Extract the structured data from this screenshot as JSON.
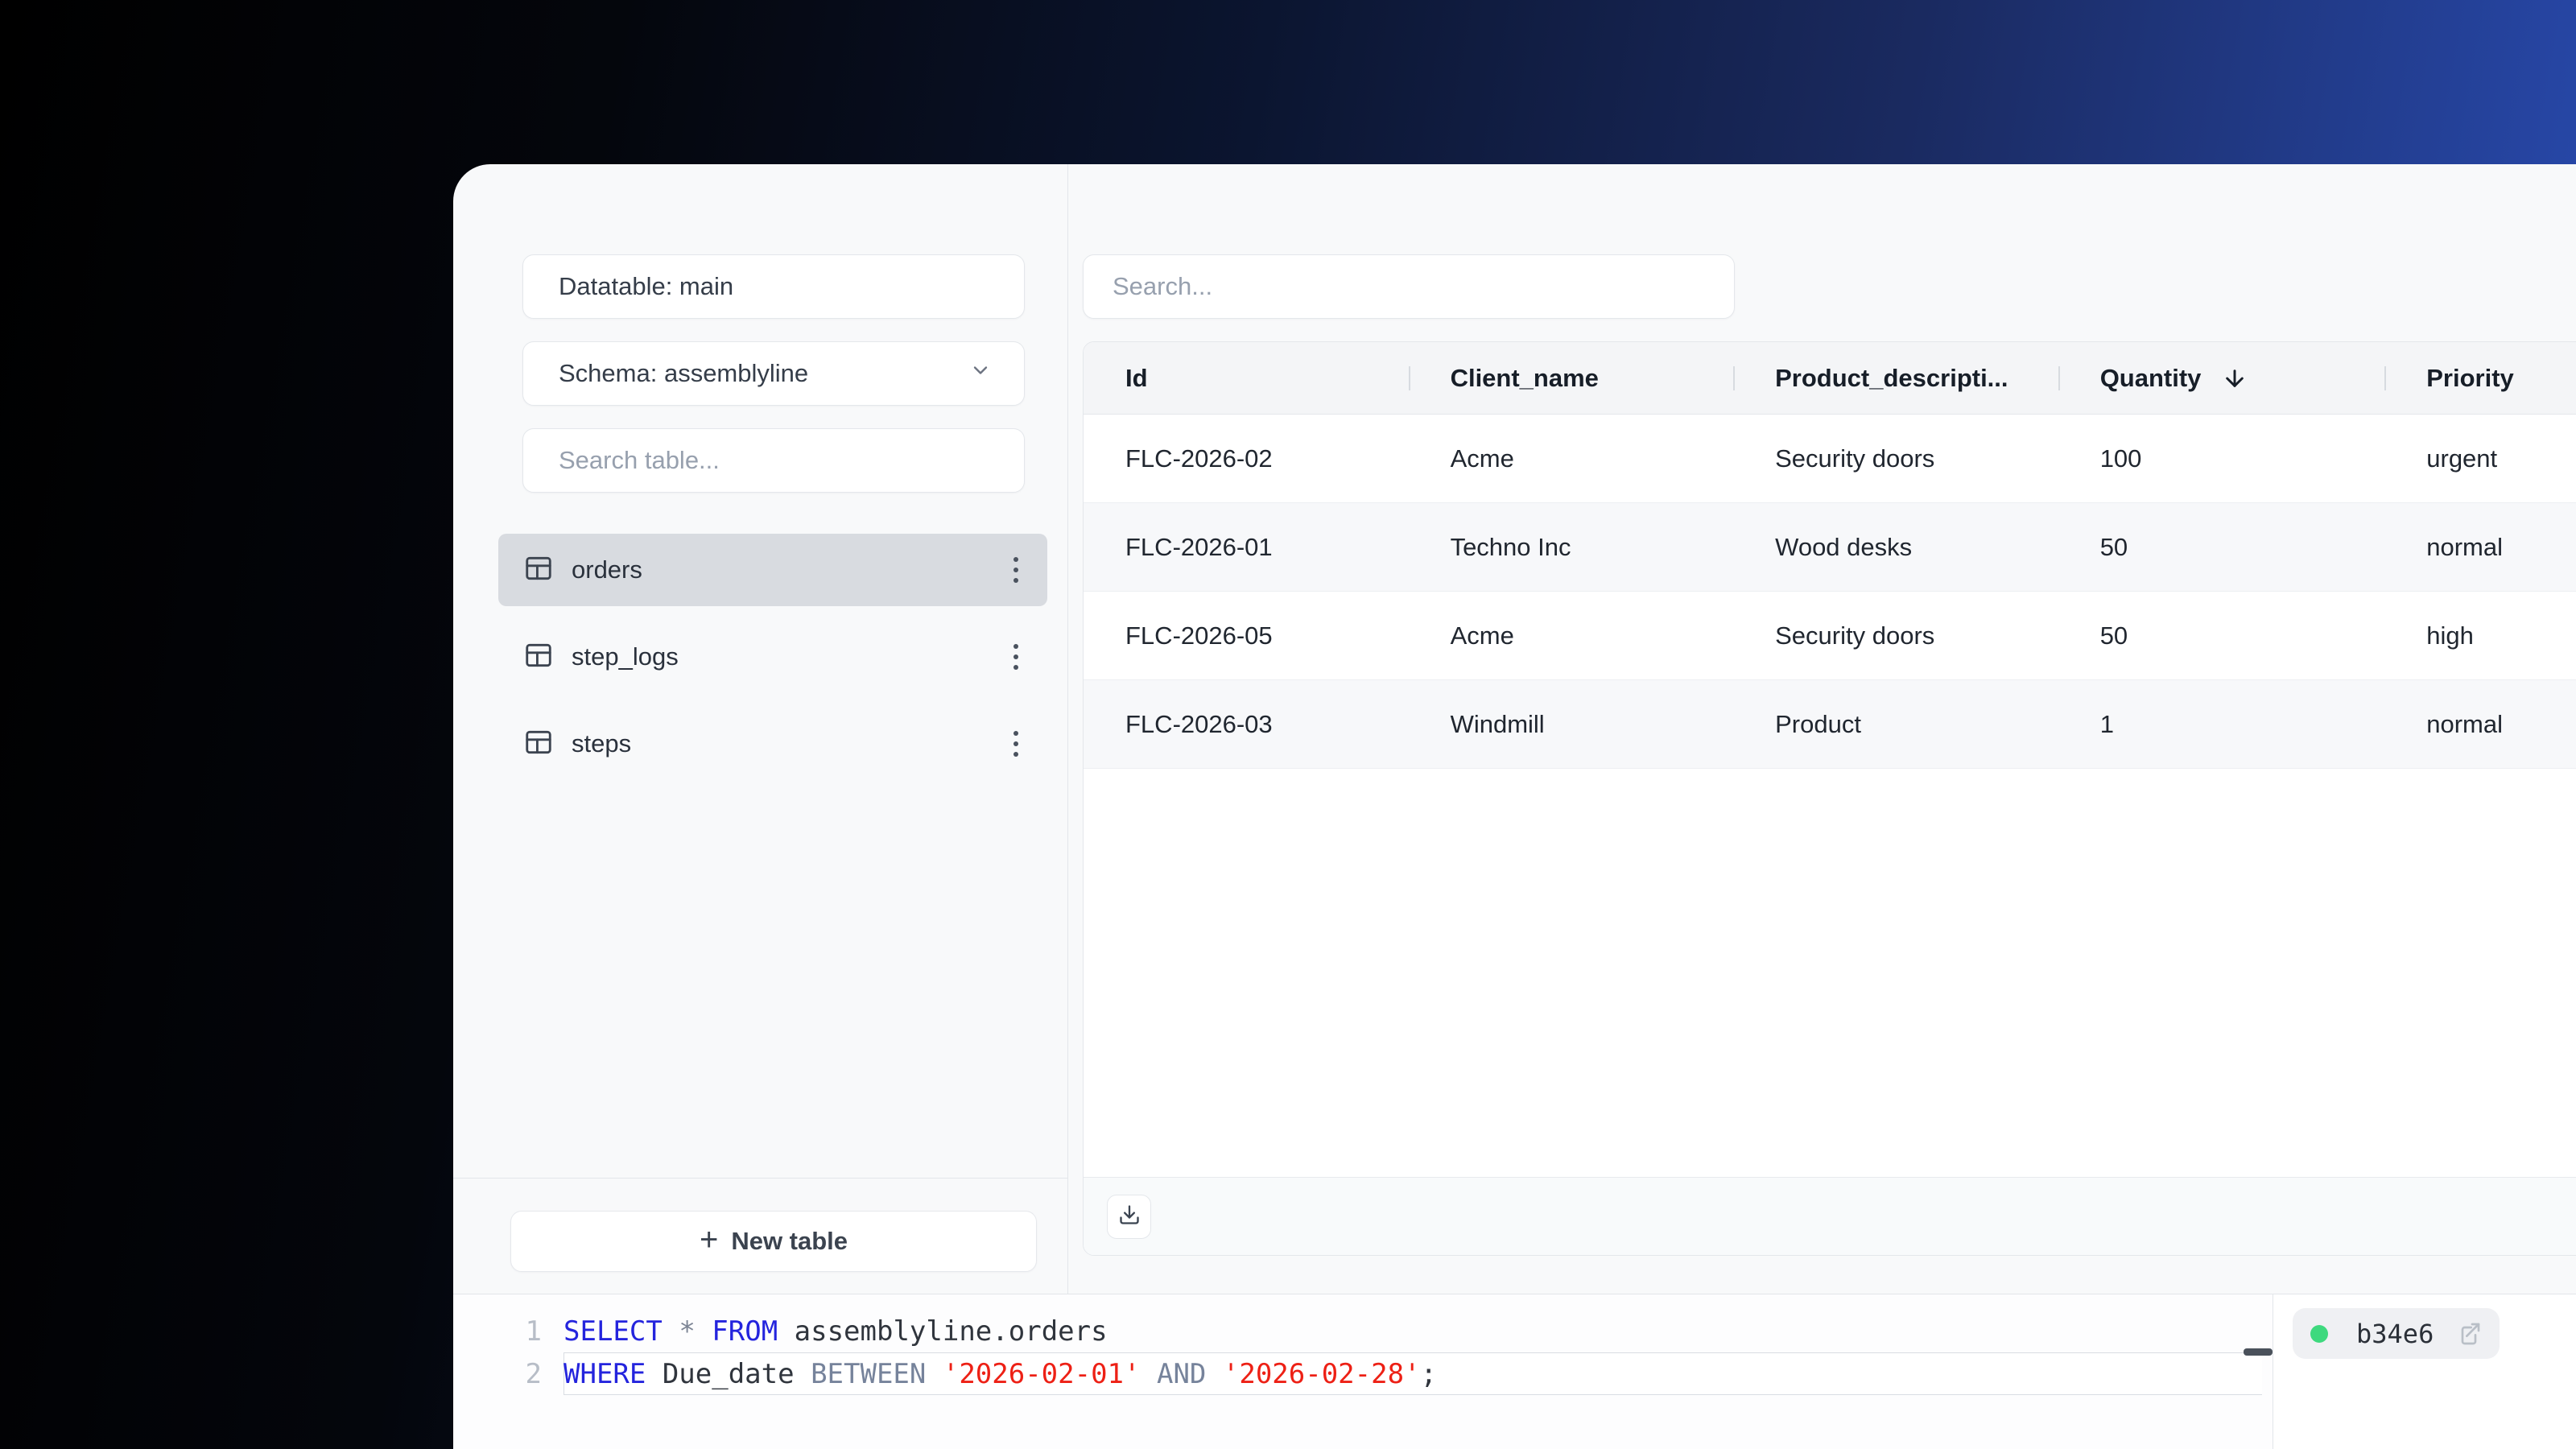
{
  "sidebar": {
    "datatable_label": "Datatable: main",
    "schema_label": "Schema: assemblyline",
    "search_placeholder": "Search table...",
    "tables": [
      {
        "name": "orders",
        "selected": true
      },
      {
        "name": "step_logs",
        "selected": false
      },
      {
        "name": "steps",
        "selected": false
      }
    ],
    "new_table_plus": "+",
    "new_table_label": "New table"
  },
  "main": {
    "search_placeholder": "Search...",
    "table": {
      "columns": [
        {
          "label": "Id",
          "sorted": "none"
        },
        {
          "label": "Client_name",
          "sorted": "none"
        },
        {
          "label": "Product_descripti...",
          "sorted": "none"
        },
        {
          "label": "Quantity",
          "sorted": "desc"
        },
        {
          "label": "Priority",
          "sorted": "none"
        }
      ],
      "rows": [
        {
          "cells": [
            "FLC-2026-02",
            "Acme",
            "Security doors",
            "100",
            "urgent"
          ]
        },
        {
          "cells": [
            "FLC-2026-01",
            "Techno Inc",
            "Wood desks",
            "50",
            "normal"
          ]
        },
        {
          "cells": [
            "FLC-2026-05",
            "Acme",
            "Security doors",
            "50",
            "high"
          ]
        },
        {
          "cells": [
            "FLC-2026-03",
            "Windmill",
            "Product",
            "1",
            "normal"
          ]
        }
      ]
    }
  },
  "editor": {
    "lines": [
      {
        "number": "1",
        "tokens": [
          {
            "t": "SELECT",
            "type": "keyword"
          },
          {
            "t": " ",
            "type": "plain"
          },
          {
            "t": "*",
            "type": "operator"
          },
          {
            "t": " ",
            "type": "plain"
          },
          {
            "t": "FROM",
            "type": "keyword"
          },
          {
            "t": " assemblyline.orders",
            "type": "plain"
          }
        ]
      },
      {
        "number": "2",
        "tokens": [
          {
            "t": "WHERE",
            "type": "keyword"
          },
          {
            "t": " Due_date ",
            "type": "plain"
          },
          {
            "t": "BETWEEN",
            "type": "modifier"
          },
          {
            "t": " ",
            "type": "plain"
          },
          {
            "t": "'2026-02-01'",
            "type": "string"
          },
          {
            "t": " ",
            "type": "plain"
          },
          {
            "t": "AND",
            "type": "modifier"
          },
          {
            "t": " ",
            "type": "plain"
          },
          {
            "t": "'2026-02-28'",
            "type": "string"
          },
          {
            "t": ";",
            "type": "plain"
          }
        ]
      }
    ],
    "syntax_colors": {
      "keyword": "#2424dd",
      "operator": "#7b8494",
      "modifier": "#76839b",
      "string": "#ed2015",
      "plain": "#30353d"
    },
    "status_badge": {
      "id": "b34e6",
      "status_color": "#3ed97e"
    }
  }
}
